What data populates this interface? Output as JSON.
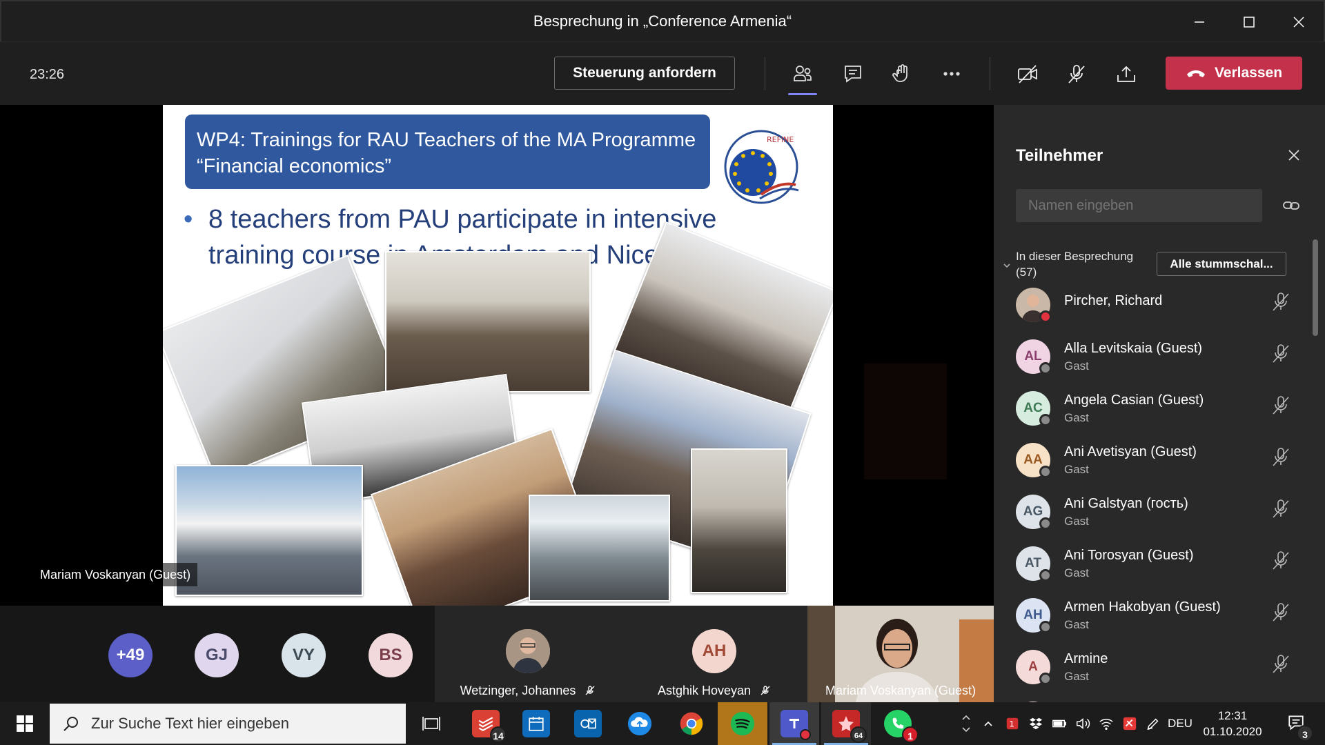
{
  "window": {
    "title": "Besprechung in „Conference Armenia“"
  },
  "toolbar": {
    "timer": "23:26",
    "request_control_label": "Steuerung anfordern",
    "leave_label": "Verlassen",
    "leave_color": "#c4314b",
    "accent_color": "#7f85f5"
  },
  "slide": {
    "header_line1": "WP4: Trainings for RAU Teachers of the MA Programme",
    "header_line2": "“Financial economics”",
    "bullet_mark": "•",
    "bullet_text": "8 teachers from PAU participate in intensive training course in Amsterdam and Nice.",
    "logo_text": "REFINE",
    "header_color": "#30589e",
    "bullet_color": "#243f7a"
  },
  "stage": {
    "speaker_label": "Mariam Voskanyan (Guest)"
  },
  "strip": {
    "avatars": [
      {
        "initials": "+49",
        "bg": "#5b5fc7",
        "fg": "#ffffff"
      },
      {
        "initials": "GJ",
        "bg": "#e0d7ee",
        "fg": "#4a4a6a"
      },
      {
        "initials": "VY",
        "bg": "#d9e4ea",
        "fg": "#3e4c55"
      },
      {
        "initials": "BS",
        "bg": "#f1d9dc",
        "fg": "#7a3f4a"
      }
    ],
    "tiles": [
      {
        "name": "Wetzinger, Johannes",
        "muted": true
      },
      {
        "name": "Astghik Hoveyan",
        "initials": "AH",
        "muted": true
      },
      {
        "name": "Mariam Voskanyan (Guest)"
      }
    ]
  },
  "panel": {
    "title": "Teilnehmer",
    "search_placeholder": "Namen eingeben",
    "section_label_line1": "In dieser Besprechung",
    "section_label_line2": "(57)",
    "mute_all_label": "Alle stummschal...",
    "participants": [
      {
        "name": "Pircher, Richard",
        "role": "",
        "initials": "",
        "avatar_bg": "#8a6c5a",
        "status": "#e0323f"
      },
      {
        "name": "Alla Levitskaia (Guest)",
        "role": "Gast",
        "initials": "AL",
        "avatar_bg": "#f0d4e4",
        "avatar_fg": "#8a3f6c",
        "status": "#8a8a8a"
      },
      {
        "name": "Angela Casian (Guest)",
        "role": "Gast",
        "initials": "AC",
        "avatar_bg": "#d6ecde",
        "avatar_fg": "#3d7a55",
        "status": "#8a8a8a"
      },
      {
        "name": "Ani Avetisyan (Guest)",
        "role": "Gast",
        "initials": "AA",
        "avatar_bg": "#f7e2c8",
        "avatar_fg": "#9a5a1f",
        "status": "#8a8a8a"
      },
      {
        "name": "Ani Galstyan (гость)",
        "role": "Gast",
        "initials": "AG",
        "avatar_bg": "#dde3e8",
        "avatar_fg": "#4a5866",
        "status": "#8a8a8a"
      },
      {
        "name": "Ani Torosyan (Guest)",
        "role": "Gast",
        "initials": "AT",
        "avatar_bg": "#dde3e8",
        "avatar_fg": "#4a5866",
        "status": "#8a8a8a"
      },
      {
        "name": "Armen Hakobyan (Guest)",
        "role": "Gast",
        "initials": "AH",
        "avatar_bg": "#dce4f4",
        "avatar_fg": "#3f5a8f",
        "status": "#8a8a8a"
      },
      {
        "name": "Armine",
        "role": "Gast",
        "initials": "A",
        "avatar_bg": "#f5dada",
        "avatar_fg": "#9a3f3f",
        "status": "#8a8a8a"
      }
    ]
  },
  "taskbar": {
    "search_placeholder": "Zur Suche Text hier eingeben",
    "badges": {
      "todoist": "14",
      "whatsapp": "1",
      "notifications": "3",
      "red_app": "64"
    },
    "language": "DEU",
    "time": "12:31",
    "date": "01.10.2020",
    "apps": [
      "windows-start",
      "task-view",
      "todoist",
      "outlook-calendar",
      "outlook",
      "onedrive",
      "chrome",
      "spotify",
      "teams",
      "red-app",
      "whatsapp"
    ]
  }
}
